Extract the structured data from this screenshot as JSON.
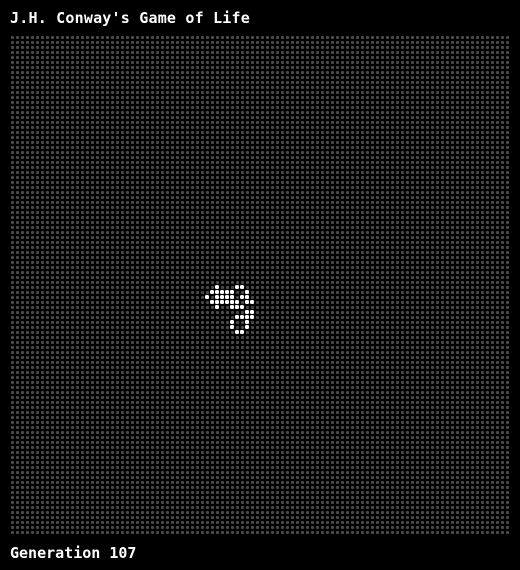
{
  "title": "J.H. Conway's Game of Life",
  "status": {
    "generation_label": "Generation 107"
  },
  "grid": {
    "columns": 100,
    "rows": 100,
    "dead_color": "#4a4a4a",
    "live_color": "#ffffff",
    "live_cells": [
      [
        41,
        50
      ],
      [
        45,
        50
      ],
      [
        46,
        50
      ],
      [
        40,
        51
      ],
      [
        41,
        51
      ],
      [
        42,
        51
      ],
      [
        43,
        51
      ],
      [
        44,
        51
      ],
      [
        47,
        51
      ],
      [
        39,
        52
      ],
      [
        41,
        52
      ],
      [
        42,
        52
      ],
      [
        43,
        52
      ],
      [
        44,
        52
      ],
      [
        46,
        52
      ],
      [
        47,
        52
      ],
      [
        40,
        53
      ],
      [
        41,
        53
      ],
      [
        42,
        53
      ],
      [
        43,
        53
      ],
      [
        44,
        53
      ],
      [
        45,
        53
      ],
      [
        47,
        53
      ],
      [
        48,
        53
      ],
      [
        41,
        54
      ],
      [
        44,
        54
      ],
      [
        45,
        54
      ],
      [
        46,
        54
      ],
      [
        47,
        55
      ],
      [
        48,
        55
      ],
      [
        45,
        56
      ],
      [
        46,
        56
      ],
      [
        47,
        56
      ],
      [
        48,
        56
      ],
      [
        44,
        57
      ],
      [
        47,
        57
      ],
      [
        44,
        58
      ],
      [
        47,
        58
      ],
      [
        45,
        59
      ],
      [
        46,
        59
      ]
    ]
  }
}
